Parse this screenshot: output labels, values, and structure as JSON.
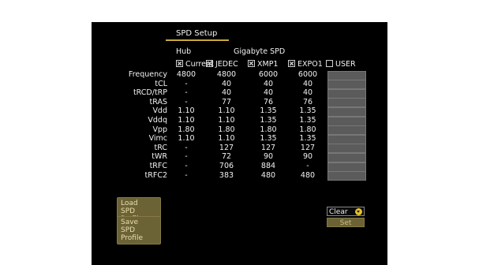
{
  "title": "SPD Setup",
  "group_hub": "Hub",
  "group_gigabyte": "Gigabyte SPD",
  "columns": [
    {
      "label": "Current",
      "checked": true
    },
    {
      "label": "JEDEC",
      "checked": true
    },
    {
      "label": "XMP1",
      "checked": true
    },
    {
      "label": "EXPO1",
      "checked": true
    },
    {
      "label": "USER",
      "checked": false
    }
  ],
  "rows": [
    {
      "label": "Frequency",
      "values": [
        "4800",
        "4800",
        "6000",
        "6000"
      ]
    },
    {
      "label": "tCL",
      "values": [
        "-",
        "40",
        "40",
        "40"
      ]
    },
    {
      "label": "tRCD/tRP",
      "values": [
        "-",
        "40",
        "40",
        "40"
      ]
    },
    {
      "label": "tRAS",
      "values": [
        "-",
        "77",
        "76",
        "76"
      ]
    },
    {
      "label": "Vdd",
      "values": [
        "1.10",
        "1.10",
        "1.35",
        "1.35"
      ]
    },
    {
      "label": "Vddq",
      "values": [
        "1.10",
        "1.10",
        "1.35",
        "1.35"
      ]
    },
    {
      "label": "Vpp",
      "values": [
        "1.80",
        "1.80",
        "1.80",
        "1.80"
      ]
    },
    {
      "label": "Vimc",
      "values": [
        "1.10",
        "1.10",
        "1.35",
        "1.35"
      ]
    },
    {
      "label": "tRC",
      "values": [
        "-",
        "127",
        "127",
        "127"
      ]
    },
    {
      "label": "tWR",
      "values": [
        "-",
        "72",
        "90",
        "90"
      ]
    },
    {
      "label": "tRFC",
      "values": [
        "-",
        "706",
        "884",
        "-"
      ]
    },
    {
      "label": "tRFC2",
      "values": [
        "-",
        "383",
        "480",
        "480"
      ]
    }
  ],
  "buttons": {
    "load_line1": "Load",
    "load_line2": "SPD Profile",
    "save_line1": "Save",
    "save_line2": "SPD Profile",
    "clear": "Clear",
    "set": "Set"
  }
}
